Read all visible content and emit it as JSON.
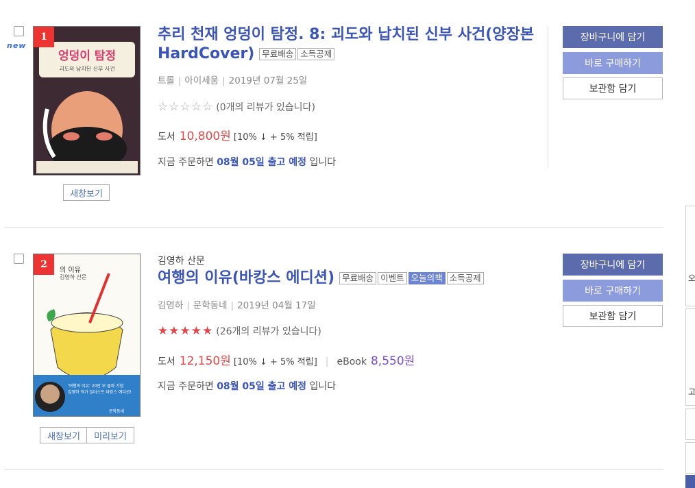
{
  "items": [
    {
      "rank": "1",
      "new_badge": "new",
      "title": "추리 천재 엉덩이 탐정. 8: 괴도와 납치된 신부 사건(양장본 HardCover)",
      "tags": [
        "무료배송",
        "소득공제"
      ],
      "author": "트롤",
      "publisher": "아이세움",
      "date": "2019년 07월 25일",
      "rating_stars": 0,
      "review_text": "(0개의 리뷰가 있습니다)",
      "price_label": "도서",
      "price": "10,800원",
      "discount": "[10% ↓ + 5% 적립]",
      "ship_prefix": "지금 주문하면",
      "ship_date": "08월 05일 출고 예정",
      "ship_suffix": "입니다",
      "preview_buttons": [
        "새창보기"
      ],
      "cover_title": "엉덩이 탐정",
      "cover_subtitle": "괴도와 납치된 신부 사건",
      "buttons": {
        "cart": "장바구니에 담기",
        "buy": "바로 구매하기",
        "keep": "보관함 담기"
      }
    },
    {
      "rank": "2",
      "byline": "김영하 산문",
      "title": "여행의 이유(바캉스 에디션)",
      "tags": [
        "무료배송",
        "이벤트",
        "오늘의책",
        "소득공제"
      ],
      "author": "김영하",
      "publisher": "문학동네",
      "date": "2019년 04월 17일",
      "rating_stars": 5,
      "review_text": "(26개의 리뷰가 있습니다)",
      "price_label": "도서",
      "price": "12,150원",
      "discount": "[10% ↓ + 5% 적립]",
      "ebook_label": "eBook",
      "ebook_price": "8,550원",
      "ship_prefix": "지금 주문하면",
      "ship_date": "08월 05일 출고 예정",
      "ship_suffix": "입니다",
      "preview_buttons": [
        "새창보기",
        "미리보기"
      ],
      "cover_title": "의 이유",
      "cover_subtitle": "김영하 산문",
      "cover_blurb": "'여행의 이유' 20만 부 돌파 기념\n김영하 작가 일러스트 바캉스 에디션!",
      "cover_publisher": "문학동네",
      "buttons": {
        "cart": "장바구니에 담기",
        "buy": "바로 구매하기",
        "keep": "보관함 담기"
      }
    }
  ],
  "right_panel": {
    "glyph1": "오",
    "glyph2": "고"
  },
  "colors": {
    "title": "#3a55b5",
    "price": "#e04848",
    "cart_btn": "#5c6bab",
    "buy_btn": "#8c9bdc",
    "rank": "#e33333"
  }
}
